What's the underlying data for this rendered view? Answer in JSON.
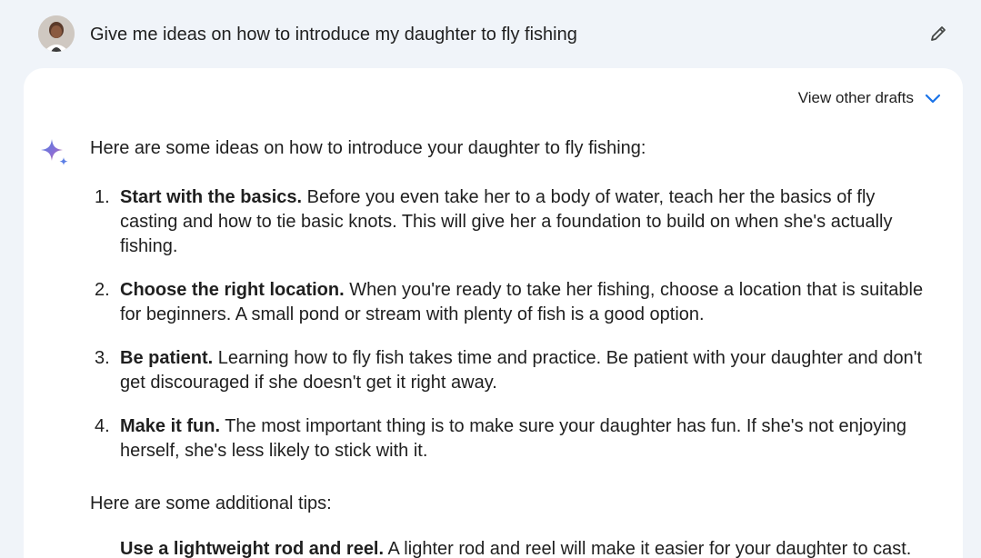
{
  "prompt": {
    "text": "Give me ideas on how to introduce my daughter to fly fishing",
    "avatar_icon": "user-avatar",
    "edit_icon": "pencil-icon"
  },
  "response": {
    "drafts_label": "View other drafts",
    "drafts_icon": "chevron-down-icon",
    "assistant_icon": "sparkle-icon",
    "intro": "Here are some ideas on how to introduce your daughter to fly fishing:",
    "ideas": [
      {
        "num": "1.",
        "title": "Start with the basics.",
        "body": " Before you even take her to a body of water, teach her the basics of fly casting and how to tie basic knots. This will give her a foundation to build on when she's actually fishing."
      },
      {
        "num": "2.",
        "title": "Choose the right location.",
        "body": " When you're ready to take her fishing, choose a location that is suitable for beginners. A small pond or stream with plenty of fish is a good option."
      },
      {
        "num": "3.",
        "title": "Be patient.",
        "body": " Learning how to fly fish takes time and practice. Be patient with your daughter and don't get discouraged if she doesn't get it right away."
      },
      {
        "num": "4.",
        "title": "Make it fun.",
        "body": " The most important thing is to make sure your daughter has fun. If she's not enjoying herself, she's less likely to stick with it."
      }
    ],
    "tips_heading": "Here are some additional tips:",
    "tip_partial_title": "Use a lightweight rod and reel.",
    "tip_partial_body": " A lighter rod and reel will make it easier for your daughter to cast."
  },
  "colors": {
    "page_bg": "#f0f4f9",
    "card_bg": "#ffffff",
    "accent_blue": "#1a73e8",
    "text": "#1f1f1f"
  }
}
